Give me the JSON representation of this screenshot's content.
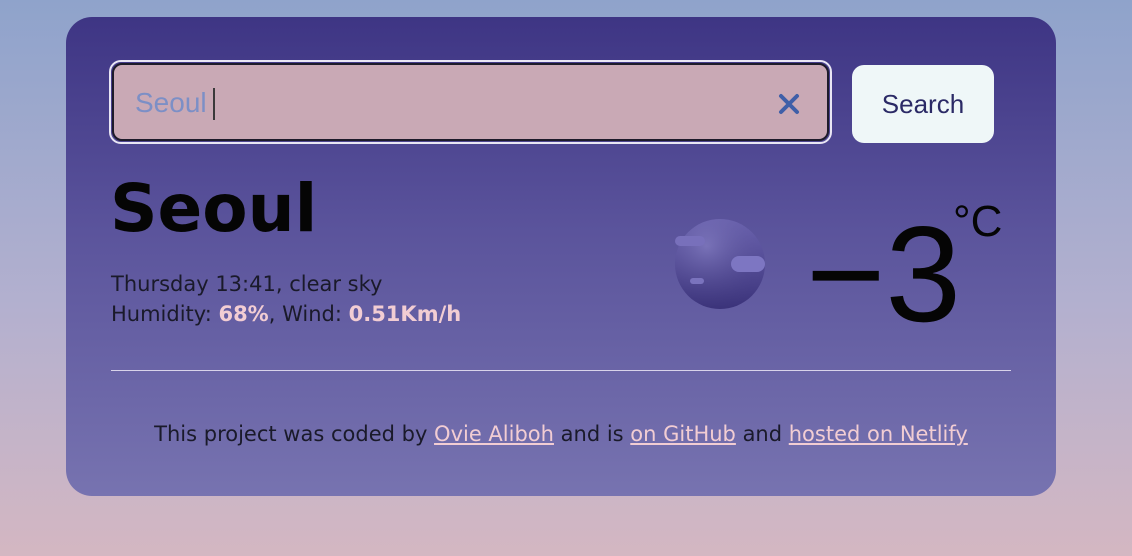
{
  "search": {
    "value": "Seoul",
    "button_label": "Search"
  },
  "weather": {
    "city": "Seoul",
    "datetime_condition": "Thursday 13:41, clear sky",
    "humidity_label": "Humidity: ",
    "humidity_value": "68%",
    "wind_separator": ", Wind: ",
    "wind_value": "0.51Km/h",
    "temperature": "−3",
    "unit": "°C",
    "icon": "moon-icon"
  },
  "footer": {
    "text_1": "This project was coded by ",
    "author_link": "Ovie Aliboh",
    "text_2": " and is ",
    "github_link": "on GitHub",
    "text_3": " and ",
    "netlify_link": "hosted on Netlify"
  },
  "colors": {
    "card_top": "#3e3584",
    "card_bottom": "#7773b0",
    "accent_text": "#f2cdd3",
    "search_bg": "#c9a9b5",
    "button_bg": "#eff7f8"
  }
}
